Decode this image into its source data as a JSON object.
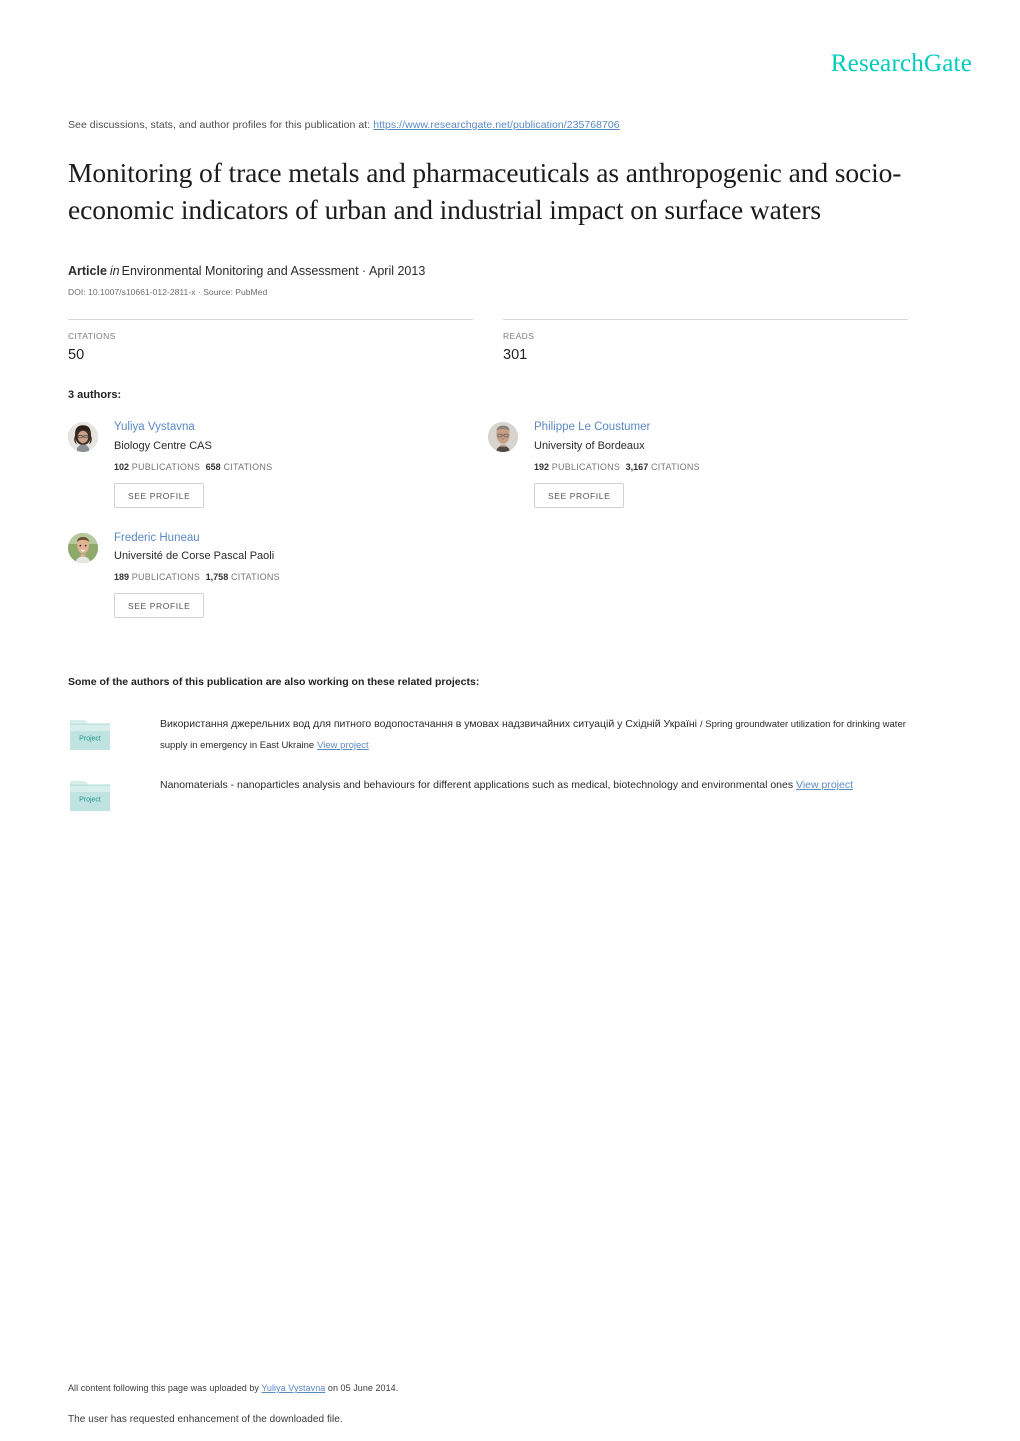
{
  "brand": {
    "name": "ResearchGate",
    "color": "#00ccbb"
  },
  "header": {
    "discussions_prefix": "See discussions, stats, and author profiles for this publication at:",
    "url": "https://www.researchgate.net/publication/235768706"
  },
  "publication": {
    "title": "Monitoring of trace metals and pharmaceuticals as anthropogenic and socio-economic indicators of urban and industrial impact on surface waters",
    "type": "Article",
    "in_word": "in",
    "venue": "Environmental Monitoring and Assessment · April 2013",
    "doi_line": "DOI: 10.1007/s10661-012-2811-x · Source: PubMed"
  },
  "stats": {
    "citations_label": "CITATIONS",
    "citations_value": "50",
    "reads_label": "READS",
    "reads_value": "301"
  },
  "authors_section": {
    "count_label": "3 authors:",
    "see_profile_label": "SEE PROFILE",
    "authors": [
      {
        "name": "Yuliya Vystavna",
        "affiliation": "Biology Centre CAS",
        "publications_count": "102",
        "publications_label": "PUBLICATIONS",
        "citations_count": "658",
        "citations_label": "CITATIONS"
      },
      {
        "name": "Philippe Le Coustumer",
        "affiliation": "University of Bordeaux",
        "publications_count": "192",
        "publications_label": "PUBLICATIONS",
        "citations_count": "3,167",
        "citations_label": "CITATIONS"
      },
      {
        "name": "Frederic Huneau",
        "affiliation": "Université de Corse Pascal Paoli",
        "publications_count": "189",
        "publications_label": "PUBLICATIONS",
        "citations_count": "1,758",
        "citations_label": "CITATIONS"
      }
    ]
  },
  "projects_section": {
    "heading": "Some of the authors of this publication are also working on these related projects:",
    "icon_label": "Project",
    "view_project_label": "View project",
    "projects": [
      {
        "title_main": "Використання джерельних вод для питного водопостачання в умовах надзвичайних ситуацій у Східній Україні",
        "title_secondary": "/ Spring groundwater utilization for drinking water supply in emergency in East Ukraine"
      },
      {
        "title_main": "Nanomaterials - nanoparticles analysis and behaviours for different applications such as medical, biotechnology and environmental ones",
        "title_secondary": ""
      }
    ]
  },
  "footer": {
    "uploaded_prefix": "All content following this page was uploaded by",
    "uploaded_by": "Yuliya Vystavna",
    "uploaded_suffix": "on 05 June 2014.",
    "enhancement_note": "The user has requested enhancement of the downloaded file."
  }
}
